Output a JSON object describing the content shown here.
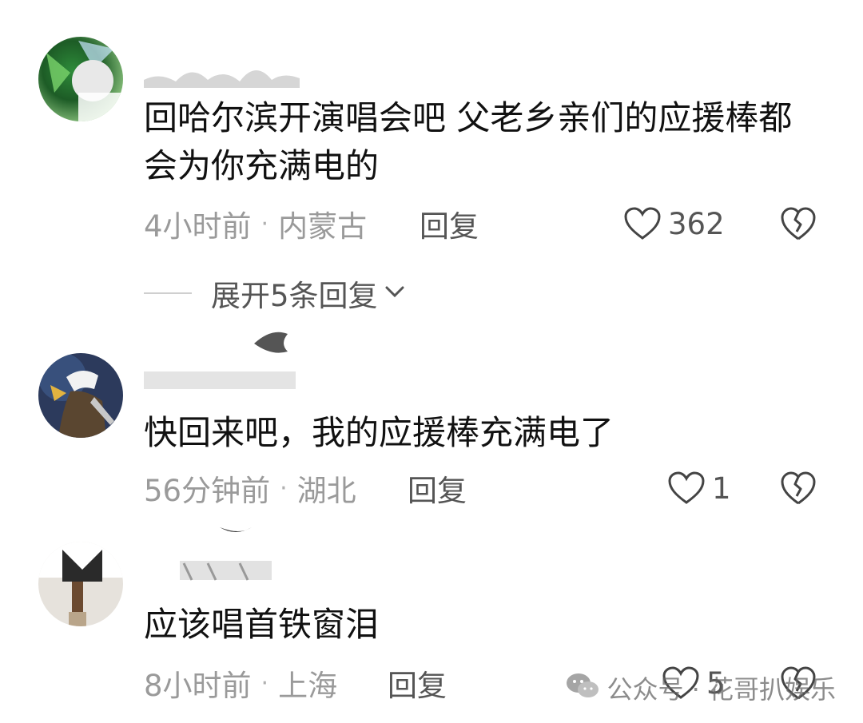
{
  "comments": [
    {
      "text": "回哈尔滨开演唱会吧 父老乡亲们的应援棒都会为你充满电的",
      "time": "4小时前",
      "separator": "·",
      "location": "内蒙古",
      "reply_label": "回复",
      "likes": "362"
    },
    {
      "text": "快回来吧，我的应援棒充满电了",
      "time": "56分钟前",
      "separator": "·",
      "location": "湖北",
      "reply_label": "回复",
      "likes": "1"
    },
    {
      "text": "应该唱首铁窗泪",
      "time": "8小时前",
      "separator": "·",
      "location": "上海",
      "reply_label": "回复",
      "likes": "5"
    }
  ],
  "expand_replies": {
    "label": "展开5条回复"
  },
  "watermark": {
    "text": "公众号 · 花哥扒娱乐"
  },
  "icons": {
    "like": "heart-outline-icon",
    "dislike": "broken-heart-icon",
    "expand": "chevron-down-icon",
    "watermark": "wechat-icon"
  },
  "colors": {
    "text_primary": "#111111",
    "text_meta": "#9a9a9a",
    "action": "#555555"
  }
}
